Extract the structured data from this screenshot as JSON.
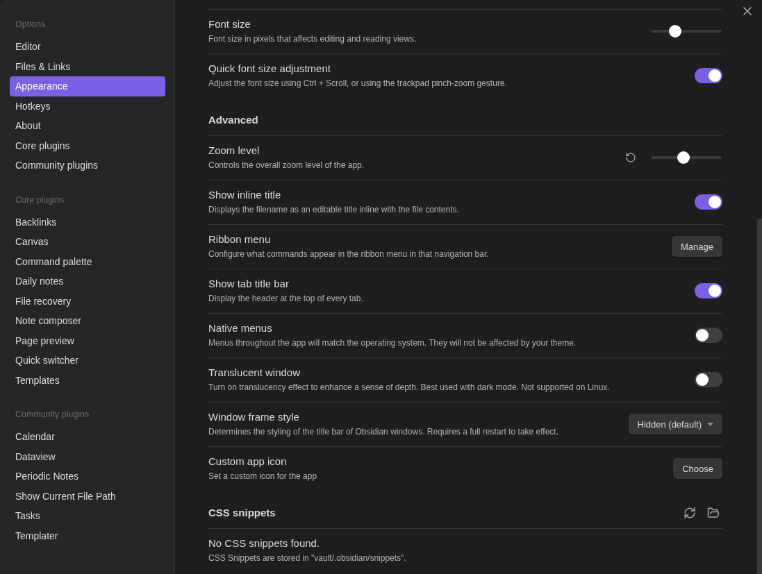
{
  "sidebar": {
    "groups": [
      {
        "title": "Options",
        "items": [
          {
            "label": "Editor",
            "selected": false
          },
          {
            "label": "Files & Links",
            "selected": false
          },
          {
            "label": "Appearance",
            "selected": true
          },
          {
            "label": "Hotkeys",
            "selected": false
          },
          {
            "label": "About",
            "selected": false
          },
          {
            "label": "Core plugins",
            "selected": false
          },
          {
            "label": "Community plugins",
            "selected": false
          }
        ]
      },
      {
        "title": "Core plugins",
        "items": [
          {
            "label": "Backlinks",
            "selected": false
          },
          {
            "label": "Canvas",
            "selected": false
          },
          {
            "label": "Command palette",
            "selected": false
          },
          {
            "label": "Daily notes",
            "selected": false
          },
          {
            "label": "File recovery",
            "selected": false
          },
          {
            "label": "Note composer",
            "selected": false
          },
          {
            "label": "Page preview",
            "selected": false
          },
          {
            "label": "Quick switcher",
            "selected": false
          },
          {
            "label": "Templates",
            "selected": false
          }
        ]
      },
      {
        "title": "Community plugins",
        "items": [
          {
            "label": "Calendar",
            "selected": false
          },
          {
            "label": "Dataview",
            "selected": false
          },
          {
            "label": "Periodic Notes",
            "selected": false
          },
          {
            "label": "Show Current File Path",
            "selected": false
          },
          {
            "label": "Tasks",
            "selected": false
          },
          {
            "label": "Templater",
            "selected": false
          }
        ]
      }
    ]
  },
  "settings": [
    {
      "kind": "slider",
      "name": "Font size",
      "description": "Font size in pixels that affects editing and reading views.",
      "level": 0.34,
      "resettable": false
    },
    {
      "kind": "toggle",
      "name": "Quick font size adjustment",
      "description": "Adjust the font size using Ctrl + Scroll, or using the trackpad pinch-zoom gesture.",
      "on": true
    },
    {
      "kind": "heading",
      "title": "Advanced",
      "actions": false
    },
    {
      "kind": "slider",
      "name": "Zoom level",
      "description": "Controls the overall zoom level of the app.",
      "level": 0.46,
      "resettable": true
    },
    {
      "kind": "toggle",
      "name": "Show inline title",
      "description": "Displays the filename as an editable title inline with the file contents.",
      "on": true
    },
    {
      "kind": "button",
      "name": "Ribbon menu",
      "description": "Configure what commands appear in the ribbon menu in that navigation bar.",
      "button": "Manage"
    },
    {
      "kind": "toggle",
      "name": "Show tab title bar",
      "description": "Display the header at the top of every tab.",
      "on": true
    },
    {
      "kind": "toggle",
      "name": "Native menus",
      "description": "Menus throughout the app will match the operating system. They will not be affected by your theme.",
      "on": false
    },
    {
      "kind": "toggle",
      "name": "Translucent window",
      "description": "Turn on translucency effect to enhance a sense of depth. Best used with dark mode. Not supported on Linux.",
      "on": false
    },
    {
      "kind": "dropdown",
      "name": "Window frame style",
      "description": "Determines the styling of the title bar of Obsidian windows. Requires a full restart to take effect.",
      "value": "Hidden (default)"
    },
    {
      "kind": "button",
      "name": "Custom app icon",
      "description": "Set a custom icon for the app",
      "button": "Choose"
    },
    {
      "kind": "heading",
      "title": "CSS snippets",
      "actions": true
    },
    {
      "kind": "info",
      "name": "No CSS snippets found.",
      "description": "CSS Snippets are stored in \"vault/.obsidian/snippets\"."
    }
  ]
}
